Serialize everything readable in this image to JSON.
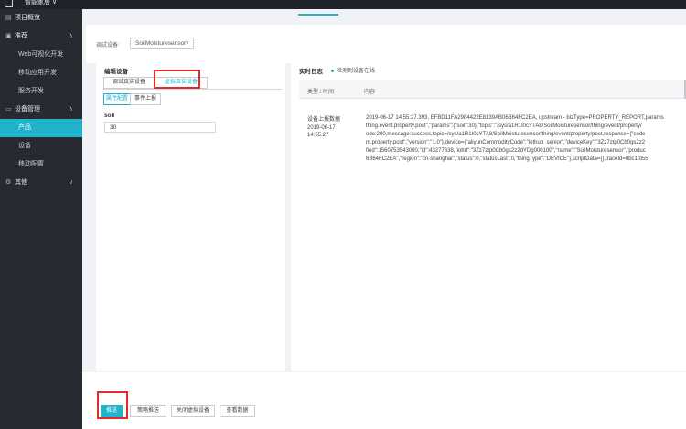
{
  "topbar": {
    "brand": "智能家居 ∨"
  },
  "sidebar": {
    "items": [
      {
        "icon": "overview-icon",
        "label": "项目概览",
        "chevron": ""
      },
      {
        "icon": "recommend-icon",
        "label": "推荐",
        "chevron": "∧"
      },
      {
        "icon": "",
        "label": "Web可视化开发",
        "chevron": ""
      },
      {
        "icon": "",
        "label": "移动应用开发",
        "chevron": ""
      },
      {
        "icon": "",
        "label": "服务开发",
        "chevron": ""
      },
      {
        "icon": "device-mgmt-icon",
        "label": "设备管理",
        "chevron": "∧"
      },
      {
        "icon": "",
        "label": "产品",
        "chevron": ""
      },
      {
        "icon": "",
        "label": "设备",
        "chevron": ""
      },
      {
        "icon": "",
        "label": "移动配置",
        "chevron": ""
      },
      {
        "icon": "other-icon",
        "label": "其他",
        "chevron": "∨"
      }
    ]
  },
  "devbar": {
    "label": "调试设备:",
    "selected_device": "SoilMoisturesensor"
  },
  "left_panel": {
    "title": "编辑设备",
    "tabs": [
      "调试真实设备",
      "虚拟真实设备"
    ],
    "sub_tabs": [
      "属性配置",
      "事件上报"
    ],
    "field_label": "soil",
    "field_value": "30"
  },
  "right_panel": {
    "title": "实时日志",
    "status": "检测到设备在线",
    "col_type": "类型 / 时间",
    "col_content": "内容",
    "log": {
      "type": "设备上报数据",
      "date": "2019-06-17\n14:55:27",
      "message": "2019-06-17 14:55:27.393, EFBD11FA2984422E8139AB06B64FC2EA, upstream - bizType=PROPERTY_REPORT,params\nthing.event.property.post\",\"params\":{\"soil\":30},\"topic\":\"/sys/a1R1I0cYTA8/SoilMoisturesensor/thing/event/property/\node:200,message:success,topic=/sys/a1R1I0cYTA8/SoilMoisturesensor/thing/event/property/post,response={\"code\nnt.property.post\",\"version\":\"1.0\"},device={\"aliyunCommodityCode\":\"iothub_senior\",\"deviceKey\":\"3Zz7ztp0Cb0gs2z2\nfied\":1560753543000,\"id\":43277638,\"iotId\":\"3Zz7ztp0Cb0gs2z2dYDg000100\",\"name\":\"SoilMoisturesensor\",\"produc\n6B64FC2EA\",\"region\":\"cn-shanghai\",\"status\":0,\"statusLast\":0,\"thingType\":\"DEVICE\"},scriptData={},traceId=0bc1fd55"
    }
  },
  "bottom_bar": {
    "push_label": "推送",
    "strategy_label": "策略推送",
    "close_label": "关闭虚拟设备",
    "view_label": "查看数据"
  },
  "colors": {
    "accent": "#21b3cc",
    "sidebar_bg": "#272b31",
    "highlight": "#e8292c"
  }
}
